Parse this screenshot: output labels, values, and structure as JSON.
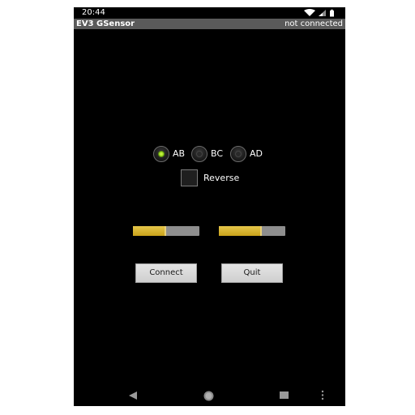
{
  "status_bar": {
    "time": "20:44",
    "icons": [
      "wifi-icon",
      "signal-icon",
      "battery-icon"
    ]
  },
  "app_bar": {
    "title": "EV3 GSensor",
    "connection_status": "not connected"
  },
  "port_selector": {
    "options": [
      {
        "label": "AB",
        "checked": true
      },
      {
        "label": "BC",
        "checked": false
      },
      {
        "label": "AD",
        "checked": false
      }
    ]
  },
  "reverse": {
    "label": "Reverse",
    "checked": false
  },
  "sliders": [
    {
      "level": 0.5
    },
    {
      "level": 0.65
    }
  ],
  "buttons": {
    "connect_label": "Connect",
    "quit_label": "Quit"
  },
  "colors": {
    "background": "#000000",
    "title_bar": "#5a5a5a",
    "radio_checked": "#a6e22e",
    "slider_fill": "#d4af2a",
    "slider_track": "#8e8e8e",
    "button_face": "#d8d8d8"
  },
  "nav_bar": {
    "icons": [
      "back-icon",
      "home-icon",
      "recents-icon",
      "menu-icon"
    ]
  }
}
